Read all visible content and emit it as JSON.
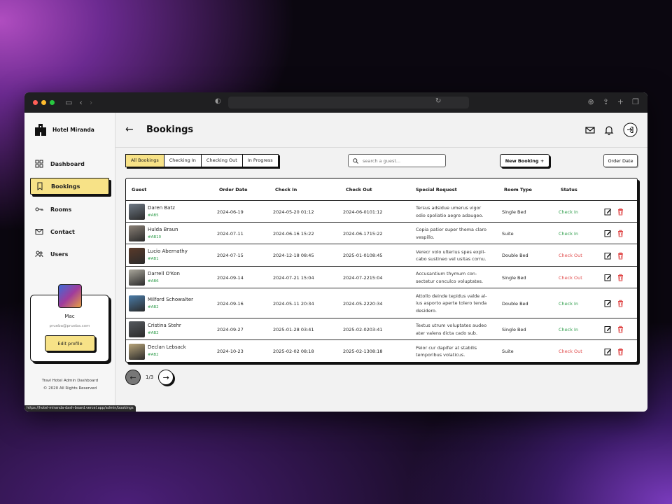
{
  "browser": {
    "status_url": "https://hotel-miranda-dash-board.vercel.app/admin/bookings"
  },
  "sidebar": {
    "brand": "Hotel Miranda",
    "items": [
      {
        "label": "Dashboard",
        "icon": "dashboard-icon",
        "active": false
      },
      {
        "label": "Bookings",
        "icon": "bookmark-icon",
        "active": true
      },
      {
        "label": "Rooms",
        "icon": "key-icon",
        "active": false
      },
      {
        "label": "Contact",
        "icon": "mail-icon",
        "active": false
      },
      {
        "label": "Users",
        "icon": "users-icon",
        "active": false
      }
    ],
    "profile": {
      "name": "Mac",
      "email": "prueba@prueba.com",
      "edit_label": "Edit profile"
    },
    "footer_line1": "Travl Hotel Admin Dashboard",
    "footer_line2": "© 2020 All Rights Reserved"
  },
  "header": {
    "title": "Bookings"
  },
  "filters": {
    "tabs": [
      "All Bookings",
      "Checking In",
      "Checking Out",
      "In Progress"
    ],
    "active_tab": "All Bookings",
    "search_placeholder": "search a guest...",
    "new_booking_label": "New Booking +",
    "order_label": "Order Date"
  },
  "table": {
    "columns": {
      "guest": "Guest",
      "order_date": "Order Date",
      "check_in": "Check In",
      "check_out": "Check Out",
      "special_request": "Special Request",
      "room_type": "Room Type",
      "status": "Status"
    },
    "rows": [
      {
        "name": "Daren Batz",
        "id": "#AB5",
        "order_date": "2024-06-19",
        "check_in": "2024-05-20 01:12",
        "check_out": "2024-06-0101:12",
        "request_1": "Tersus adsidue umerus vigor",
        "request_2": "odio spoliatio aegre adaugeo.",
        "request_3": "",
        "room_type": "Single Bed",
        "status": "Check In",
        "status_kind": "in",
        "thumb_color": "#6f7a86"
      },
      {
        "name": "Hulda Braun",
        "id": "#AB10",
        "order_date": "2024-07-11",
        "check_in": "2024-06-16 15:22",
        "check_out": "2024-06-1715:22",
        "request_1": "Copia patior super thema claro",
        "request_2": "vespillo.",
        "request_3": "",
        "room_type": "Suite",
        "status": "Check In",
        "status_kind": "in",
        "thumb_color": "#8a8076"
      },
      {
        "name": "Lucio Abernathy",
        "id": "#AB1",
        "order_date": "2024-07-15",
        "check_in": "2024-12-18 08:45",
        "check_out": "2025-01-0108:45",
        "request_1": "Verecr volo ulterius spes expli-",
        "request_2": "cabo sustineo vel usitas cornu.",
        "request_3": "",
        "room_type": "Double Bed",
        "status": "Check Out",
        "status_kind": "out",
        "thumb_color": "#5a3a2a"
      },
      {
        "name": "Darrell O'Kon",
        "id": "#AB6",
        "order_date": "2024-09-14",
        "check_in": "2024-07-21 15:04",
        "check_out": "2024-07-2215:04",
        "request_1": "Accusantium thymum con-",
        "request_2": "sectetur conculco voluptates.",
        "request_3": "",
        "room_type": "Single Bed",
        "status": "Check Out",
        "status_kind": "out",
        "thumb_color": "#a9a69b"
      },
      {
        "name": "Milford Schowalter",
        "id": "#AB2",
        "order_date": "2024-09-16",
        "check_in": "2024-05-11 20:34",
        "check_out": "2024-05-2220:34",
        "request_1": "Attollo deinde tepidus valde al-",
        "request_2": "ius asporto aperte tolero tenda",
        "request_3": "desidero.",
        "room_type": "Double Bed",
        "status": "Check In",
        "status_kind": "in",
        "thumb_color": "#4a7ca8"
      },
      {
        "name": "Cristina Stehr",
        "id": "#AB2",
        "order_date": "2024-09-27",
        "check_in": "2025-01-28 03:41",
        "check_out": "2025-02-0203:41",
        "request_1": "Textus utrum voluptates audeo",
        "request_2": "ater valens dicta cado sub.",
        "request_3": "",
        "room_type": "Single Bed",
        "status": "Check In",
        "status_kind": "in",
        "thumb_color": "#55595e"
      },
      {
        "name": "Declan Lebsack",
        "id": "#AB2",
        "order_date": "2024-10-23",
        "check_in": "2025-02-02 08:18",
        "check_out": "2025-02-1308:18",
        "request_1": "Peior cur dapifer at stabilis",
        "request_2": "temporibus volaticus.",
        "request_3": "",
        "room_type": "Suite",
        "status": "Check Out",
        "status_kind": "out",
        "thumb_color": "#b8a57a"
      }
    ]
  },
  "pagination": {
    "text": "1/3"
  },
  "colors": {
    "accent_yellow": "#f7e287",
    "status_in": "#2e9c4a",
    "status_out": "#e04a4a"
  }
}
